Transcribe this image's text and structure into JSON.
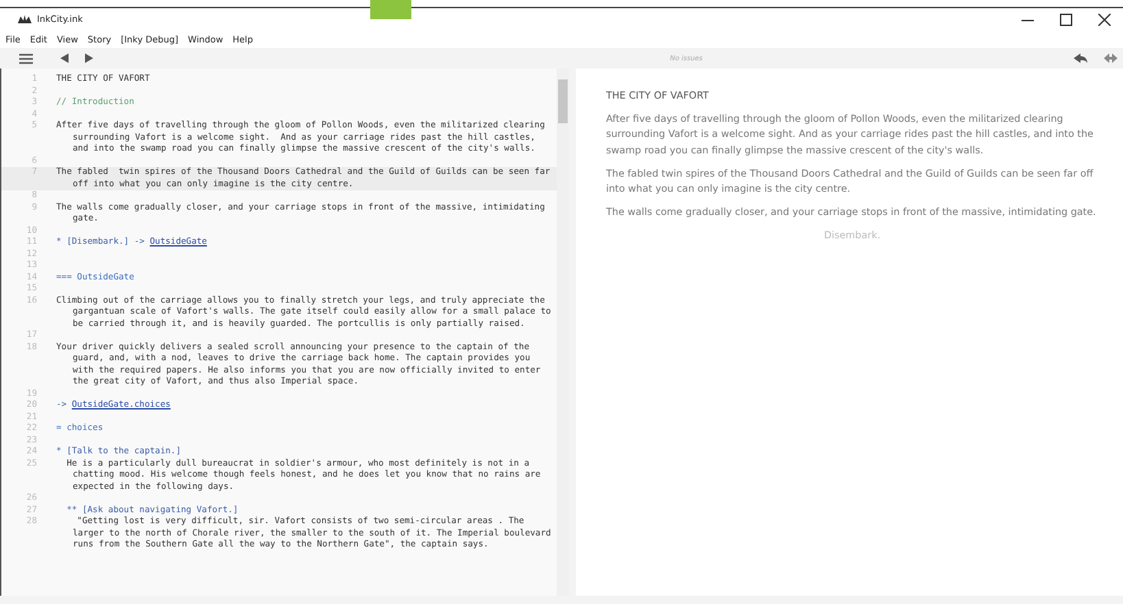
{
  "window": {
    "title": "InkCity.ink",
    "controls": [
      {
        "kind": "minimize"
      },
      {
        "kind": "maximize"
      },
      {
        "kind": "close"
      }
    ]
  },
  "menu": [
    "File",
    "Edit",
    "View",
    "Story",
    "[Inky Debug]",
    "Window",
    "Help"
  ],
  "toolbar": {
    "status": "No issues"
  },
  "editor": {
    "lines": [
      {
        "number": "1",
        "kind": "text",
        "text": "THE CITY OF VAFORT",
        "selected": false
      },
      {
        "number": "2",
        "kind": "blank",
        "selected": false
      },
      {
        "number": "3",
        "kind": "comment",
        "text": "// Introduction",
        "selected": false
      },
      {
        "number": "4",
        "kind": "blank",
        "selected": false
      },
      {
        "number": "5",
        "kind": "text",
        "text": "After five days of travelling through the gloom of Pollon Woods, even the militarized clearing surrounding Vafort is a welcome sight.  And as your carriage rides past the hill castles, and into the swamp road you can finally glimpse the massive crescent of the city's walls.",
        "selected": false
      },
      {
        "number": "6",
        "kind": "blank",
        "selected": false
      },
      {
        "number": "7",
        "kind": "text",
        "text": "The fabled  twin spires of the Thousand Doors Cathedral and the Guild of Guilds can be seen far off into what you can only imagine is the city centre.",
        "selected": true
      },
      {
        "number": "8",
        "kind": "blank",
        "selected": false
      },
      {
        "number": "9",
        "kind": "text",
        "text": "The walls come gradually closer, and your carriage stops in front of the massive, intimidating gate.",
        "selected": false
      },
      {
        "number": "10",
        "kind": "blank",
        "selected": false
      },
      {
        "number": "11",
        "kind": "divert",
        "text": "* [Disembark.] -> ",
        "link": "OutsideGate",
        "selected": false
      },
      {
        "number": "12",
        "kind": "blank",
        "selected": false
      },
      {
        "number": "13",
        "kind": "blank",
        "selected": false
      },
      {
        "number": "14",
        "kind": "knot",
        "text": "=== OutsideGate",
        "selected": false
      },
      {
        "number": "15",
        "kind": "blank",
        "selected": false
      },
      {
        "number": "16",
        "kind": "text",
        "text": "Climbing out of the carriage allows you to finally stretch your legs, and truly appreciate the gargantuan scale of Vafort's walls. The gate itself could easily allow for a small palace to be carried through it, and is heavily guarded. The portcullis is only partially raised.",
        "selected": false
      },
      {
        "number": "17",
        "kind": "blank",
        "selected": false
      },
      {
        "number": "18",
        "kind": "text",
        "text": "Your driver quickly delivers a sealed scroll announcing your presence to the captain of the guard, and, with a nod, leaves to drive the carriage back home. The captain provides you with the required papers. He also informs you that you are now officially invited to enter the great city of Vafort, and thus also Imperial space.",
        "selected": false
      },
      {
        "number": "19",
        "kind": "blank",
        "selected": false
      },
      {
        "number": "20",
        "kind": "divert",
        "text": "-> ",
        "link": "OutsideGate.choices",
        "selected": false
      },
      {
        "number": "21",
        "kind": "blank",
        "selected": false
      },
      {
        "number": "22",
        "kind": "knot",
        "text": "= choices",
        "selected": false
      },
      {
        "number": "23",
        "kind": "blank",
        "selected": false
      },
      {
        "number": "24",
        "kind": "choice",
        "text": "* [Talk to the captain.]",
        "selected": false
      },
      {
        "number": "25",
        "kind": "text",
        "text": "  He is a particularly dull bureaucrat in soldier's armour, who most definitely is not in a chatting mood. His welcome though feels honest, and he does let you know that no rains are expected in the following days.",
        "selected": false
      },
      {
        "number": "26",
        "kind": "blank",
        "selected": false
      },
      {
        "number": "27",
        "kind": "choice",
        "text": "  ** [Ask about navigating Vafort.]",
        "selected": false
      },
      {
        "number": "28",
        "kind": "text",
        "text": "    \"Getting lost is very difficult, sir. Vafort consists of two semi-circular areas . The larger to the north of Chorale river, the smaller to the south of it. The Imperial boulevard runs from the Southern Gate all the way to the Northern Gate\", the captain says.",
        "selected": false
      }
    ]
  },
  "player": {
    "title": "THE CITY OF VAFORT",
    "paragraphs": [
      "After five days of travelling through the gloom of Pollon Woods, even the militarized clearing surrounding Vafort is a welcome sight. And as your carriage rides past the hill castles, and into the swamp road you can finally glimpse the massive crescent of the city's walls.",
      "The fabled twin spires of the Thousand Doors Cathedral and the Guild of Guilds can be seen far off into what you can only imagine is the city centre.",
      "The walls come gradually closer, and your carriage stops in front of the massive, intimidating gate."
    ],
    "choices": [
      "Disembark."
    ]
  }
}
